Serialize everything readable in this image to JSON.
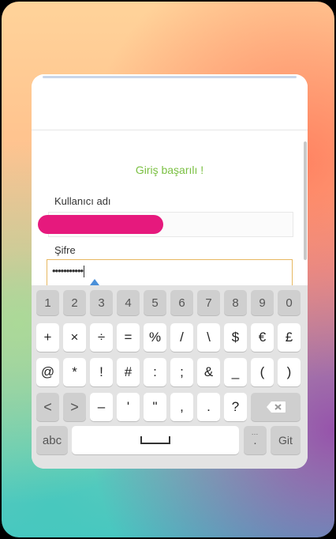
{
  "form": {
    "success_message": "Giriş başarılı !",
    "username_label": "Kullanıcı adı",
    "password_label": "Şifre",
    "password_value": "•••••••••••"
  },
  "keyboard": {
    "row1": [
      "1",
      "2",
      "3",
      "4",
      "5",
      "6",
      "7",
      "8",
      "9",
      "0"
    ],
    "row2": [
      "+",
      "×",
      "÷",
      "=",
      "%",
      "/",
      "\\",
      "$",
      "€",
      "£"
    ],
    "row3": [
      "@",
      "*",
      "!",
      "#",
      ":",
      ";",
      "&",
      "_",
      "(",
      ")"
    ],
    "row4": [
      "<",
      ">",
      "–",
      "'",
      "\"",
      ",",
      ".",
      "?"
    ],
    "mode_label": "abc",
    "period_label": ".",
    "period_hint": "…",
    "go_label": "Git"
  },
  "colors": {
    "success": "#7bc043",
    "focus_border": "#e7b861",
    "redaction": "#e6197d"
  }
}
